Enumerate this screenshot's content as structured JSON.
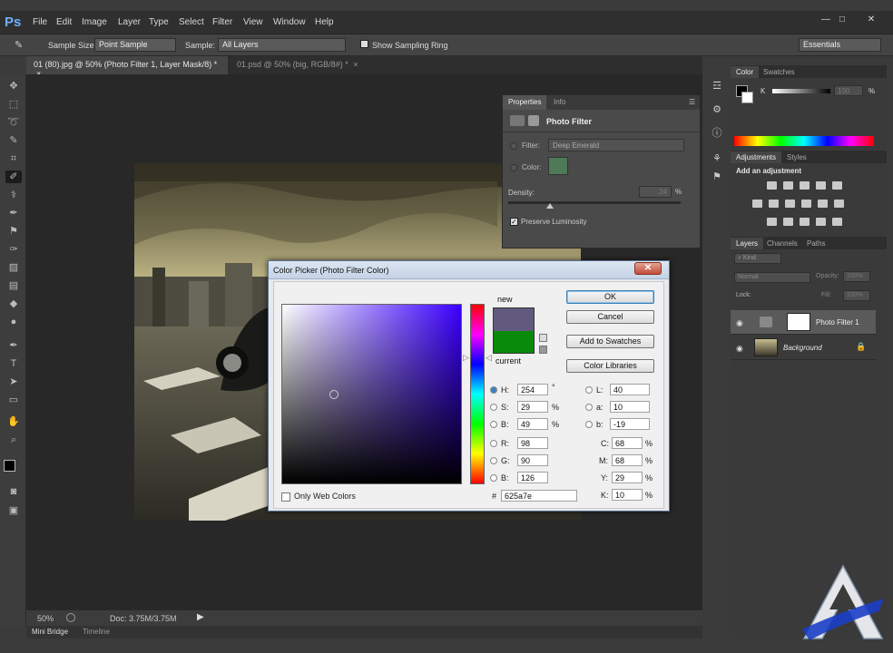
{
  "app": {
    "logo": "Ps"
  },
  "menu": [
    "File",
    "Edit",
    "Image",
    "Layer",
    "Type",
    "Select",
    "Filter",
    "View",
    "Window",
    "Help"
  ],
  "window_buttons": [
    "—",
    "□",
    "✕"
  ],
  "options": {
    "sample_size_label": "Sample Size:",
    "sample_size_value": "Point Sample",
    "sample_label": "Sample:",
    "sample_value": "All Layers",
    "show_ring_label": "Show Sampling Ring",
    "workspace": "Essentials"
  },
  "tabs": [
    {
      "label": "01 (80).jpg @ 50% (Photo Filter 1, Layer Mask/8) *",
      "close": "×"
    },
    {
      "label": "01.psd @ 50% (big, RGB/8#) *",
      "close": "×"
    }
  ],
  "status": {
    "zoom": "50%",
    "doc": "Doc: 3.75M/3.75M"
  },
  "bottom_tabs": [
    "Mini Bridge",
    "Timeline"
  ],
  "properties": {
    "tabs": [
      "Properties",
      "Info"
    ],
    "title": "Photo Filter",
    "filter_label": "Filter:",
    "filter_value": "Deep Emerald",
    "color_label": "Color:",
    "color_value": "#4f7a57",
    "density_label": "Density:",
    "density_value": "24",
    "density_unit": "%",
    "density_fraction": 0.24,
    "preserve_label": "Preserve Luminosity"
  },
  "color_panel": {
    "tabs": [
      "Color",
      "Swatches"
    ],
    "k_label": "K",
    "k_value": "100",
    "k_unit": "%"
  },
  "adjustments": {
    "tabs": [
      "Adjustments",
      "Styles"
    ],
    "heading": "Add an adjustment"
  },
  "layers": {
    "tabs": [
      "Layers",
      "Channels",
      "Paths"
    ],
    "kind": "⌕ Kind",
    "blend": "Normal",
    "opacity_label": "Opacity:",
    "opacity_value": "100%",
    "lock_label": "Lock:",
    "fill_label": "Fill:",
    "fill_value": "100%",
    "items": [
      {
        "name": "Photo Filter 1"
      },
      {
        "name": "Background"
      }
    ]
  },
  "dialog": {
    "title": "Color Picker (Photo Filter Color)",
    "close": "✕",
    "new_label": "new",
    "current_label": "current",
    "new_color": "#625a7e",
    "current_color": "#0a8a0a",
    "buttons": {
      "ok": "OK",
      "cancel": "Cancel",
      "add_swatches": "Add to Swatches",
      "color_libraries": "Color Libraries"
    },
    "hsb": {
      "h_label": "H:",
      "h_value": "254",
      "h_unit": "°",
      "s_label": "S:",
      "s_value": "29",
      "s_unit": "%",
      "b_label": "B:",
      "b_value": "49",
      "b_unit": "%"
    },
    "rgb": {
      "r_label": "R:",
      "r_value": "98",
      "g_label": "G:",
      "g_value": "90",
      "b_label": "B:",
      "b_value": "126"
    },
    "lab": {
      "l_label": "L:",
      "l_value": "40",
      "a_label": "a:",
      "a_value": "10",
      "b_label": "b:",
      "b_value": "-19"
    },
    "cmyk": {
      "c_label": "C:",
      "c_value": "68",
      "m_label": "M:",
      "m_value": "68",
      "y_label": "Y:",
      "y_value": "29",
      "k_label": "K:",
      "k_value": "10",
      "unit": "%"
    },
    "hex_label": "#",
    "hex_value": "625a7e",
    "web_colors_label": "Only Web Colors"
  }
}
